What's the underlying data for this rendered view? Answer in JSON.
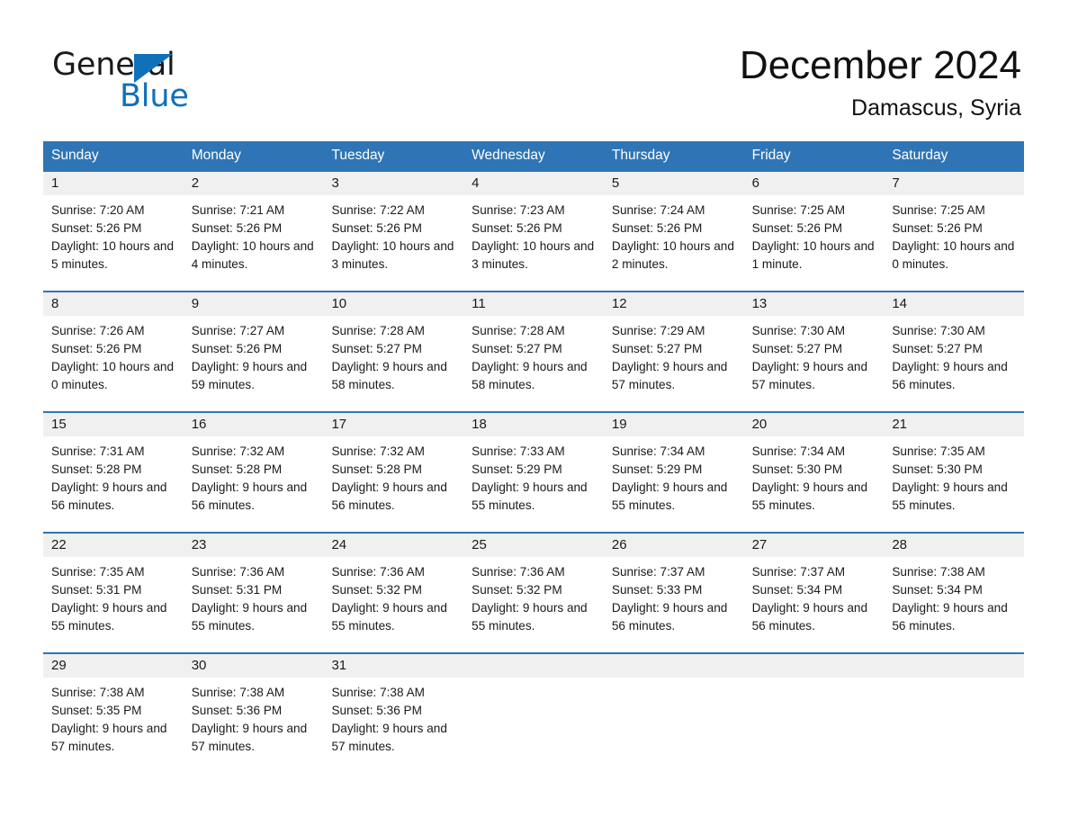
{
  "logo": {
    "word_one": "General",
    "word_two": "Blue",
    "triangle_icon": "triangle-icon",
    "accent_color": "#0f71b9"
  },
  "header": {
    "title": "December 2024",
    "location": "Damascus, Syria"
  },
  "theme": {
    "header_blue": "#2f75b5",
    "day_band_gray": "#f0f0f0",
    "text_color": "#1a1a1a"
  },
  "weekdays": [
    "Sunday",
    "Monday",
    "Tuesday",
    "Wednesday",
    "Thursday",
    "Friday",
    "Saturday"
  ],
  "weeks": [
    [
      {
        "day": "1",
        "sunrise": "Sunrise: 7:20 AM",
        "sunset": "Sunset: 5:26 PM",
        "daylight": "Daylight: 10 hours and 5 minutes."
      },
      {
        "day": "2",
        "sunrise": "Sunrise: 7:21 AM",
        "sunset": "Sunset: 5:26 PM",
        "daylight": "Daylight: 10 hours and 4 minutes."
      },
      {
        "day": "3",
        "sunrise": "Sunrise: 7:22 AM",
        "sunset": "Sunset: 5:26 PM",
        "daylight": "Daylight: 10 hours and 3 minutes."
      },
      {
        "day": "4",
        "sunrise": "Sunrise: 7:23 AM",
        "sunset": "Sunset: 5:26 PM",
        "daylight": "Daylight: 10 hours and 3 minutes."
      },
      {
        "day": "5",
        "sunrise": "Sunrise: 7:24 AM",
        "sunset": "Sunset: 5:26 PM",
        "daylight": "Daylight: 10 hours and 2 minutes."
      },
      {
        "day": "6",
        "sunrise": "Sunrise: 7:25 AM",
        "sunset": "Sunset: 5:26 PM",
        "daylight": "Daylight: 10 hours and 1 minute."
      },
      {
        "day": "7",
        "sunrise": "Sunrise: 7:25 AM",
        "sunset": "Sunset: 5:26 PM",
        "daylight": "Daylight: 10 hours and 0 minutes."
      }
    ],
    [
      {
        "day": "8",
        "sunrise": "Sunrise: 7:26 AM",
        "sunset": "Sunset: 5:26 PM",
        "daylight": "Daylight: 10 hours and 0 minutes."
      },
      {
        "day": "9",
        "sunrise": "Sunrise: 7:27 AM",
        "sunset": "Sunset: 5:26 PM",
        "daylight": "Daylight: 9 hours and 59 minutes."
      },
      {
        "day": "10",
        "sunrise": "Sunrise: 7:28 AM",
        "sunset": "Sunset: 5:27 PM",
        "daylight": "Daylight: 9 hours and 58 minutes."
      },
      {
        "day": "11",
        "sunrise": "Sunrise: 7:28 AM",
        "sunset": "Sunset: 5:27 PM",
        "daylight": "Daylight: 9 hours and 58 minutes."
      },
      {
        "day": "12",
        "sunrise": "Sunrise: 7:29 AM",
        "sunset": "Sunset: 5:27 PM",
        "daylight": "Daylight: 9 hours and 57 minutes."
      },
      {
        "day": "13",
        "sunrise": "Sunrise: 7:30 AM",
        "sunset": "Sunset: 5:27 PM",
        "daylight": "Daylight: 9 hours and 57 minutes."
      },
      {
        "day": "14",
        "sunrise": "Sunrise: 7:30 AM",
        "sunset": "Sunset: 5:27 PM",
        "daylight": "Daylight: 9 hours and 56 minutes."
      }
    ],
    [
      {
        "day": "15",
        "sunrise": "Sunrise: 7:31 AM",
        "sunset": "Sunset: 5:28 PM",
        "daylight": "Daylight: 9 hours and 56 minutes."
      },
      {
        "day": "16",
        "sunrise": "Sunrise: 7:32 AM",
        "sunset": "Sunset: 5:28 PM",
        "daylight": "Daylight: 9 hours and 56 minutes."
      },
      {
        "day": "17",
        "sunrise": "Sunrise: 7:32 AM",
        "sunset": "Sunset: 5:28 PM",
        "daylight": "Daylight: 9 hours and 56 minutes."
      },
      {
        "day": "18",
        "sunrise": "Sunrise: 7:33 AM",
        "sunset": "Sunset: 5:29 PM",
        "daylight": "Daylight: 9 hours and 55 minutes."
      },
      {
        "day": "19",
        "sunrise": "Sunrise: 7:34 AM",
        "sunset": "Sunset: 5:29 PM",
        "daylight": "Daylight: 9 hours and 55 minutes."
      },
      {
        "day": "20",
        "sunrise": "Sunrise: 7:34 AM",
        "sunset": "Sunset: 5:30 PM",
        "daylight": "Daylight: 9 hours and 55 minutes."
      },
      {
        "day": "21",
        "sunrise": "Sunrise: 7:35 AM",
        "sunset": "Sunset: 5:30 PM",
        "daylight": "Daylight: 9 hours and 55 minutes."
      }
    ],
    [
      {
        "day": "22",
        "sunrise": "Sunrise: 7:35 AM",
        "sunset": "Sunset: 5:31 PM",
        "daylight": "Daylight: 9 hours and 55 minutes."
      },
      {
        "day": "23",
        "sunrise": "Sunrise: 7:36 AM",
        "sunset": "Sunset: 5:31 PM",
        "daylight": "Daylight: 9 hours and 55 minutes."
      },
      {
        "day": "24",
        "sunrise": "Sunrise: 7:36 AM",
        "sunset": "Sunset: 5:32 PM",
        "daylight": "Daylight: 9 hours and 55 minutes."
      },
      {
        "day": "25",
        "sunrise": "Sunrise: 7:36 AM",
        "sunset": "Sunset: 5:32 PM",
        "daylight": "Daylight: 9 hours and 55 minutes."
      },
      {
        "day": "26",
        "sunrise": "Sunrise: 7:37 AM",
        "sunset": "Sunset: 5:33 PM",
        "daylight": "Daylight: 9 hours and 56 minutes."
      },
      {
        "day": "27",
        "sunrise": "Sunrise: 7:37 AM",
        "sunset": "Sunset: 5:34 PM",
        "daylight": "Daylight: 9 hours and 56 minutes."
      },
      {
        "day": "28",
        "sunrise": "Sunrise: 7:38 AM",
        "sunset": "Sunset: 5:34 PM",
        "daylight": "Daylight: 9 hours and 56 minutes."
      }
    ],
    [
      {
        "day": "29",
        "sunrise": "Sunrise: 7:38 AM",
        "sunset": "Sunset: 5:35 PM",
        "daylight": "Daylight: 9 hours and 57 minutes."
      },
      {
        "day": "30",
        "sunrise": "Sunrise: 7:38 AM",
        "sunset": "Sunset: 5:36 PM",
        "daylight": "Daylight: 9 hours and 57 minutes."
      },
      {
        "day": "31",
        "sunrise": "Sunrise: 7:38 AM",
        "sunset": "Sunset: 5:36 PM",
        "daylight": "Daylight: 9 hours and 57 minutes."
      },
      {
        "day": "",
        "sunrise": "",
        "sunset": "",
        "daylight": ""
      },
      {
        "day": "",
        "sunrise": "",
        "sunset": "",
        "daylight": ""
      },
      {
        "day": "",
        "sunrise": "",
        "sunset": "",
        "daylight": ""
      },
      {
        "day": "",
        "sunrise": "",
        "sunset": "",
        "daylight": ""
      }
    ]
  ]
}
